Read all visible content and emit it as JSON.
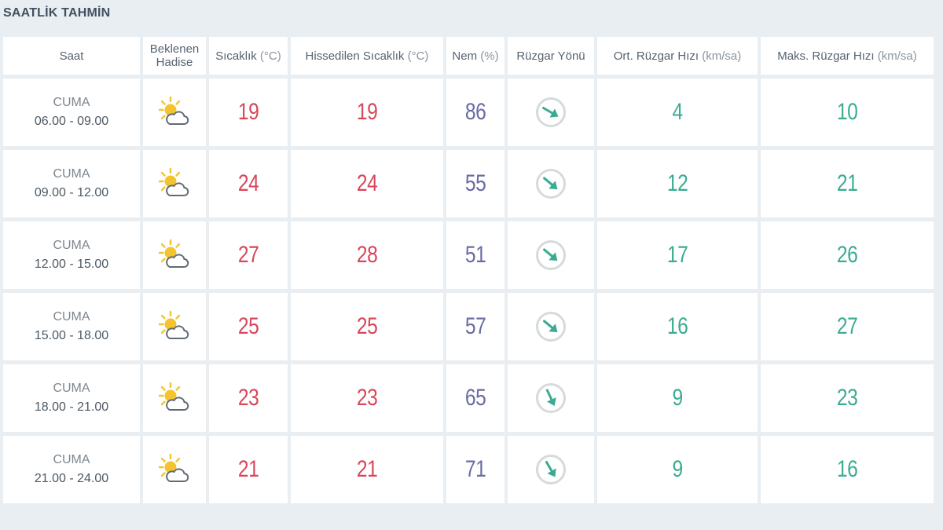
{
  "section_title": "SAATLİK TAHMİN",
  "headers": {
    "saat": "Saat",
    "hadise_line1": "Beklenen",
    "hadise_line2": "Hadise",
    "sicaklik": "Sıcaklık",
    "sicaklik_unit": "(°C)",
    "hissedilen": "Hissedilen Sıcaklık",
    "hissedilen_unit": "(°C)",
    "nem": "Nem",
    "nem_unit": "(%)",
    "ruzgar_yonu": "Rüzgar Yönü",
    "ort_ruzgar": "Ort. Rüzgar Hızı",
    "ort_ruzgar_unit": "(km/sa)",
    "maks_ruzgar": "Maks. Rüzgar Hızı",
    "maks_ruzgar_unit": "(km/sa)"
  },
  "rows": [
    {
      "day": "CUMA",
      "range": "06.00 - 09.00",
      "icon": "sun-cloud-icon",
      "temp": "19",
      "feels": "19",
      "humidity": "86",
      "wind_dir_deg": 120,
      "wind_avg": "4",
      "wind_max": "10"
    },
    {
      "day": "CUMA",
      "range": "09.00 - 12.00",
      "icon": "sun-cloud-icon",
      "temp": "24",
      "feels": "24",
      "humidity": "55",
      "wind_dir_deg": 130,
      "wind_avg": "12",
      "wind_max": "21"
    },
    {
      "day": "CUMA",
      "range": "12.00 - 15.00",
      "icon": "sun-cloud-icon",
      "temp": "27",
      "feels": "28",
      "humidity": "51",
      "wind_dir_deg": 130,
      "wind_avg": "17",
      "wind_max": "26"
    },
    {
      "day": "CUMA",
      "range": "15.00 - 18.00",
      "icon": "sun-cloud-icon",
      "temp": "25",
      "feels": "25",
      "humidity": "57",
      "wind_dir_deg": 130,
      "wind_avg": "16",
      "wind_max": "27"
    },
    {
      "day": "CUMA",
      "range": "18.00 - 21.00",
      "icon": "sun-cloud-icon",
      "temp": "23",
      "feels": "23",
      "humidity": "65",
      "wind_dir_deg": 155,
      "wind_avg": "9",
      "wind_max": "23"
    },
    {
      "day": "CUMA",
      "range": "21.00 - 24.00",
      "icon": "sun-cloud-icon",
      "temp": "21",
      "feels": "21",
      "humidity": "71",
      "wind_dir_deg": 150,
      "wind_avg": "9",
      "wind_max": "16"
    }
  ],
  "colors": {
    "temperature": "#d8465a",
    "humidity": "#6a6ba4",
    "wind": "#3aab92",
    "sun": "#f4c430",
    "cloud": "#5f6b76"
  }
}
